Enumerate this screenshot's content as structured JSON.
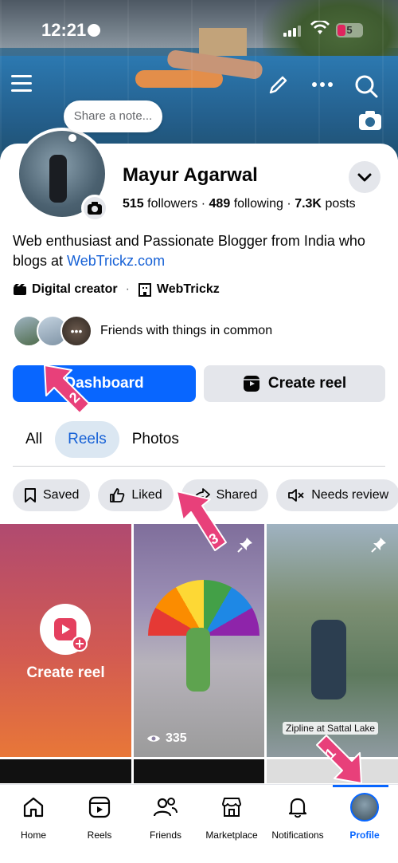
{
  "status_bar": {
    "time": "12:21",
    "battery": "5"
  },
  "cover": {},
  "note": {
    "placeholder": "Share a note..."
  },
  "profile": {
    "name": "Mayur Agarwal",
    "followers_count": "515",
    "followers_label": "followers",
    "following_count": "489",
    "following_label": "following",
    "posts_count": "7.3K",
    "posts_label": "posts",
    "bio_text": "Web enthusiast and Passionate Blogger from India who blogs at ",
    "bio_link": "WebTrickz.com",
    "category": "Digital creator",
    "page": "WebTrickz",
    "friends_text": "Friends with things in common"
  },
  "buttons": {
    "dashboard": "Dashboard",
    "create_reel": "Create reel"
  },
  "tabs": [
    {
      "label": "All"
    },
    {
      "label": "Reels"
    },
    {
      "label": "Photos"
    }
  ],
  "chips": [
    {
      "label": "Saved",
      "icon": "bookmark-icon"
    },
    {
      "label": "Liked",
      "icon": "thumbs-up-icon"
    },
    {
      "label": "Shared",
      "icon": "share-icon"
    },
    {
      "label": "Needs review",
      "icon": "muted-speaker-icon"
    }
  ],
  "grid": {
    "create_reel_label": "Create reel",
    "reel1_views": "335",
    "reel2_caption": "Zipline at Sattal Lake"
  },
  "bottom_nav": [
    {
      "label": "Home"
    },
    {
      "label": "Reels"
    },
    {
      "label": "Friends"
    },
    {
      "label": "Marketplace"
    },
    {
      "label": "Notifications"
    },
    {
      "label": "Profile"
    }
  ],
  "annotations": [
    "1",
    "2",
    "3"
  ],
  "colors": {
    "accent": "#0866ff",
    "annotation": "#e8407a",
    "link": "#1661d6"
  }
}
